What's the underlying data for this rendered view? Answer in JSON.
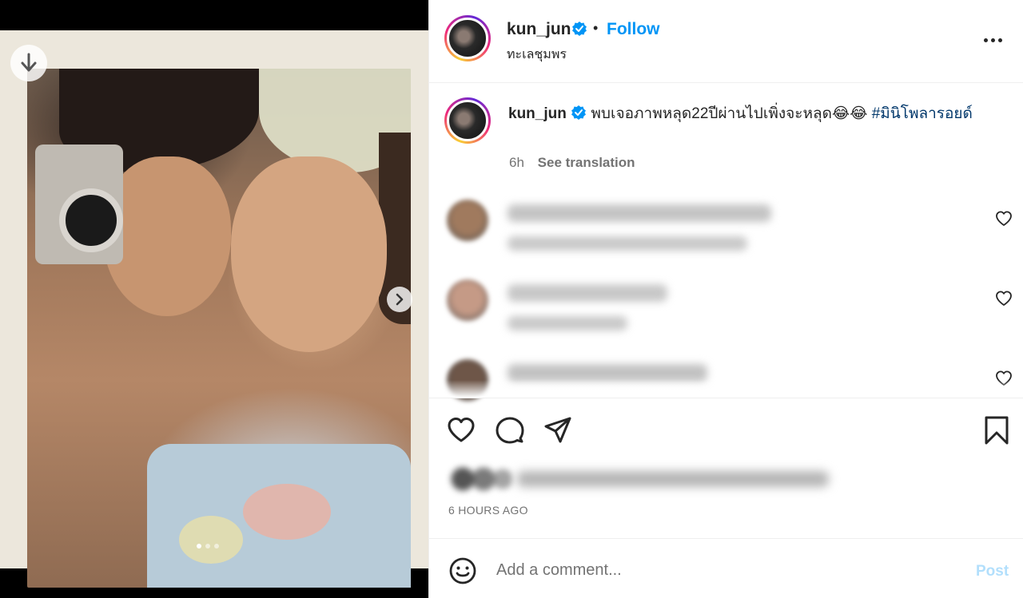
{
  "post": {
    "media": {
      "image_alt": "Polaroid photo of a man holding a vintage film camera and a smiling woman in a bandana",
      "carousel": {
        "count": 3,
        "active_index": 0
      }
    },
    "header": {
      "username": "kun_jun",
      "verified": true,
      "separator": "•",
      "follow_label": "Follow",
      "location": "ทะเลชุมพร"
    },
    "caption": {
      "username": "kun_jun",
      "text": "พบเจอภาพหลุด22ปีผ่านไปเพิ่งจะหลุด😂😂",
      "hashtag": "#มินิโพลารอยด์",
      "time": "6h",
      "translate_label": "See translation"
    },
    "comments": [
      {
        "obscured": true,
        "avatar_color": "#a07a5e",
        "line1_color": "#c4c4c4",
        "line1_width": 330,
        "line2_width": 300
      },
      {
        "obscured": true,
        "avatar_color": "#c59a86",
        "line1_color": "#c8c8c8",
        "line1_width": 200,
        "line2_width": 150
      },
      {
        "obscured": true,
        "avatar_color": "#6e5648",
        "line1_color": "#c2c2c2",
        "line1_width": 250,
        "line2_width": 0
      }
    ],
    "footer": {
      "liked_by_obscured": true,
      "time_ago": "6 HOURS AGO"
    },
    "add_comment": {
      "placeholder": "Add a comment...",
      "post_label": "Post"
    }
  },
  "colors": {
    "accent": "#0095f6",
    "hashtag": "#00376b",
    "muted": "#737373",
    "post_disabled": "#b2dffc"
  }
}
